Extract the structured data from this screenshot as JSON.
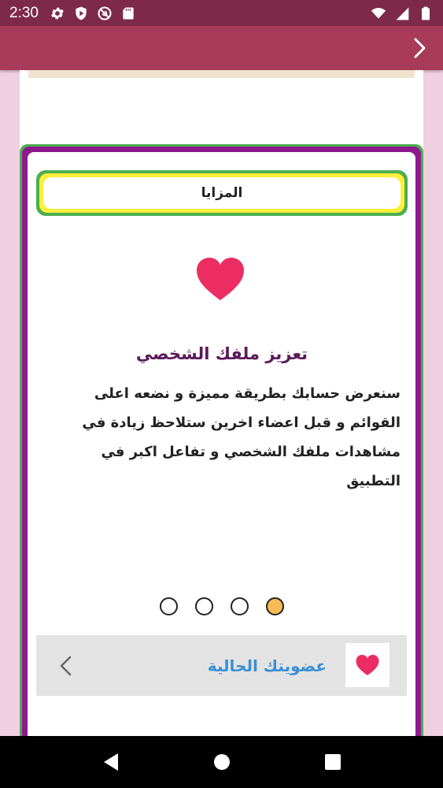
{
  "status_bar": {
    "time": "2:30",
    "icons_left": [
      "gear-icon",
      "shield-play-icon",
      "blocked-icon",
      "sd-card-icon"
    ],
    "icons_right": [
      "wifi-icon",
      "signal-icon",
      "battery-icon"
    ]
  },
  "app_bar": {
    "nav_icon": "chevron-right-icon"
  },
  "card": {
    "section_title": "المزايا",
    "feature_icon": "heart-icon",
    "feature_title": "تعزيز ملفك الشخصي",
    "feature_description": "سنعرض حسابك بطريقة مميزة و نضعه اعلى القوائم و قبل اعضاء اخرين ستلاحظ زيادة في مشاهدات ملفك الشخصي و تفاعل اكبر في التطبيق",
    "pager": {
      "total": 4,
      "active_index": 3
    },
    "membership": {
      "label": "عضويتك الحالية",
      "icon": "heart-icon",
      "arrow_icon": "chevron-left-icon"
    }
  },
  "colors": {
    "status_bar": "#7d2a48",
    "app_bar": "#a83a5a",
    "card_border_green": "#4caf50",
    "card_border_purple": "#8e1a8e",
    "title_yellow": "#ffee3b",
    "heart": "#ec2d63",
    "feature_title": "#5b1a5b",
    "membership_text": "#3a8fd6",
    "dot_active": "#f7bb55"
  },
  "nav_bar": {
    "buttons": [
      "back-icon",
      "home-icon",
      "recents-icon"
    ]
  }
}
